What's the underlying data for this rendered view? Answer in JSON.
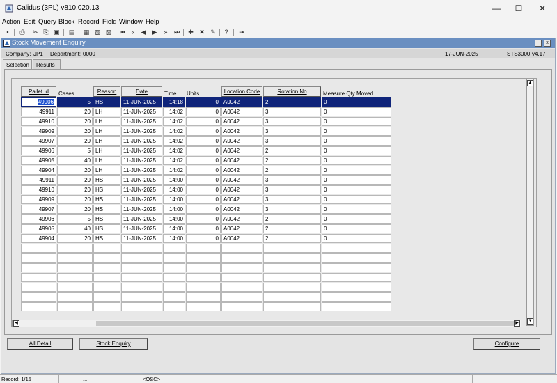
{
  "window": {
    "title": "Calidus (3PL) v810.020.13",
    "controls": {
      "minimize": "—",
      "maximize": "☐",
      "close": "✕"
    }
  },
  "menu": [
    "Action",
    "Edit",
    "Query",
    "Block",
    "Record",
    "Field",
    "Window",
    "Help"
  ],
  "toolbar": {
    "icons": [
      "save-icon",
      "print-icon",
      "cut-icon",
      "copy-icon",
      "paste-icon",
      "clear-icon",
      "lock-icon",
      "open-icon",
      "filter-icon",
      "first-record-icon",
      "prev-set-icon",
      "prev-record-icon",
      "next-record-icon",
      "next-set-icon",
      "last-record-icon",
      "insert-record-icon",
      "delete-record-icon",
      "clear-record-icon",
      "help-icon",
      "exit-icon"
    ],
    "glyphs": [
      "▪",
      "⎙",
      "✂",
      "⎘",
      "▣",
      "▤",
      "▦",
      "▧",
      "▨",
      "⏮",
      "«",
      "◀",
      "▶",
      "»",
      "⏭",
      "✚",
      "✖",
      "✎",
      "?",
      "⇥"
    ]
  },
  "frame": {
    "title": "Stock Movement Enquiry",
    "minimize": "_",
    "close": "x"
  },
  "info": {
    "company_label": "Company:",
    "company_value": "JP1",
    "department_label": "Department:",
    "department_value": "0000",
    "date": "17-JUN-2025",
    "screen_id": "STS3000",
    "version": "v4.17"
  },
  "tabs": [
    "Selection",
    "Results"
  ],
  "table": {
    "headers": [
      "Pallet Id",
      "Cases",
      "Reason",
      "Date",
      "Time",
      "Units",
      "Location Code",
      "Rotation No",
      "Measure Qty Moved"
    ],
    "rows": [
      [
        "49906",
        "5",
        "HS",
        "11-JUN-2025",
        "14:18",
        "0",
        "A0042",
        "2",
        "0"
      ],
      [
        "49911",
        "20",
        "LH",
        "11-JUN-2025",
        "14:02",
        "0",
        "A0042",
        "3",
        "0"
      ],
      [
        "49910",
        "20",
        "LH",
        "11-JUN-2025",
        "14:02",
        "0",
        "A0042",
        "3",
        "0"
      ],
      [
        "49909",
        "20",
        "LH",
        "11-JUN-2025",
        "14:02",
        "0",
        "A0042",
        "3",
        "0"
      ],
      [
        "49907",
        "20",
        "LH",
        "11-JUN-2025",
        "14:02",
        "0",
        "A0042",
        "3",
        "0"
      ],
      [
        "49906",
        "5",
        "LH",
        "11-JUN-2025",
        "14:02",
        "0",
        "A0042",
        "2",
        "0"
      ],
      [
        "49905",
        "40",
        "LH",
        "11-JUN-2025",
        "14:02",
        "0",
        "A0042",
        "2",
        "0"
      ],
      [
        "49904",
        "20",
        "LH",
        "11-JUN-2025",
        "14:02",
        "0",
        "A0042",
        "2",
        "0"
      ],
      [
        "49911",
        "20",
        "HS",
        "11-JUN-2025",
        "14:00",
        "0",
        "A0042",
        "3",
        "0"
      ],
      [
        "49910",
        "20",
        "HS",
        "11-JUN-2025",
        "14:00",
        "0",
        "A0042",
        "3",
        "0"
      ],
      [
        "49909",
        "20",
        "HS",
        "11-JUN-2025",
        "14:00",
        "0",
        "A0042",
        "3",
        "0"
      ],
      [
        "49907",
        "20",
        "HS",
        "11-JUN-2025",
        "14:00",
        "0",
        "A0042",
        "3",
        "0"
      ],
      [
        "49906",
        "5",
        "HS",
        "11-JUN-2025",
        "14:00",
        "0",
        "A0042",
        "2",
        "0"
      ],
      [
        "49905",
        "40",
        "HS",
        "11-JUN-2025",
        "14:00",
        "0",
        "A0042",
        "2",
        "0"
      ],
      [
        "49904",
        "20",
        "HS",
        "11-JUN-2025",
        "14:00",
        "0",
        "A0042",
        "2",
        "0"
      ]
    ],
    "empty_rows": 7
  },
  "buttons": {
    "all_detail": "All Detail",
    "stock_enquiry": "Stock Enquiry",
    "configure": "Configure"
  },
  "status": {
    "record": "Record: 1/15",
    "dots": "...",
    "osc": "<OSC>"
  },
  "colors": {
    "frame_title": "#6a8fc1",
    "selected_row": "#0f247a"
  }
}
